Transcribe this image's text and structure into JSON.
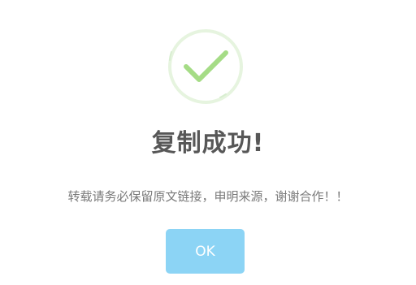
{
  "dialog": {
    "icon": "success-checkmark-icon",
    "title": "复制成功!",
    "message": "转载请务必保留原文链接，申明来源，谢谢合作！！",
    "ok_label": "OK"
  },
  "colors": {
    "accent": "#8cd4f5",
    "success_ring": "#e3f3dc",
    "success_check": "#a5dc86",
    "title": "#575757",
    "message": "#797979"
  }
}
